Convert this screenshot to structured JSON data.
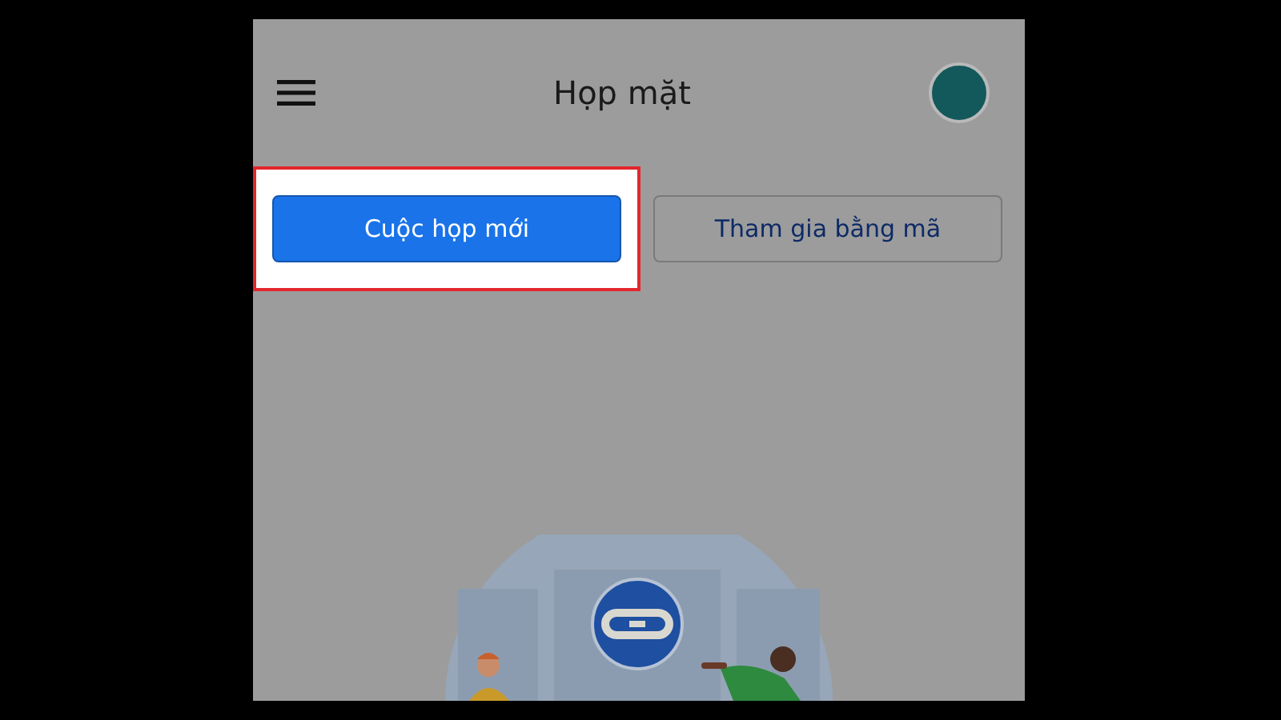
{
  "app_bar": {
    "title": "Họp mặt"
  },
  "buttons": [
    {
      "label": "Cuộc họp mới",
      "kind": "primary",
      "highlighted": true
    },
    {
      "label": "Tham gia bằng mã",
      "kind": "secondary",
      "highlighted": false
    }
  ]
}
